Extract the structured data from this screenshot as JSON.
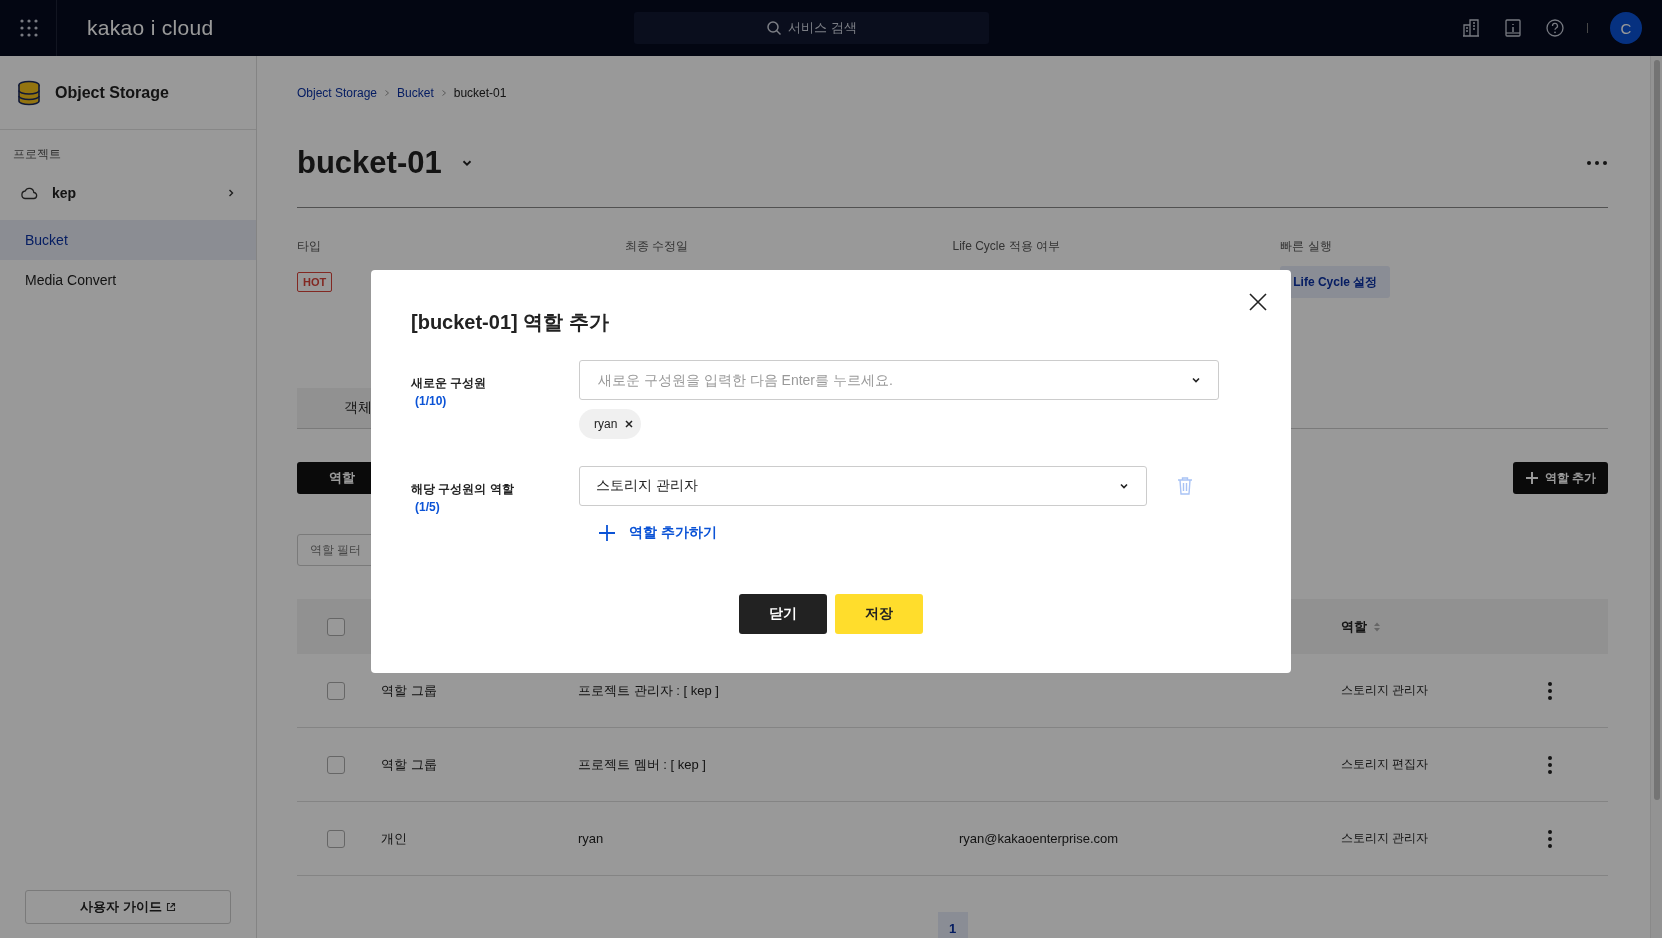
{
  "topbar": {
    "brand": "kakao i cloud",
    "search_placeholder": "서비스 검색",
    "avatar": "C"
  },
  "sidebar": {
    "service": "Object Storage",
    "section_label": "프로젝트",
    "project": "kep",
    "items": [
      {
        "label": "Bucket",
        "selected": true
      },
      {
        "label": "Media Convert",
        "selected": false
      }
    ],
    "guide_link": "사용자 가이드"
  },
  "breadcrumb": [
    "Object Storage",
    "Bucket",
    "bucket-01"
  ],
  "title": "bucket-01",
  "info": [
    {
      "label": "타입",
      "kind": "badge",
      "value": "HOT"
    },
    {
      "label": "최종 수정일"
    },
    {
      "label": "Life Cycle 적용 여부"
    },
    {
      "label": "빠른 실행",
      "kind": "button",
      "value": "Life Cycle 설정"
    }
  ],
  "tabs": [
    {
      "label": "객체",
      "selected": false
    }
  ],
  "role_toolbar": {
    "segment": "역할",
    "add_button": "역할 추가",
    "filter_placeholder": "역할 필터"
  },
  "table": {
    "select_all_checked": false,
    "role_header": "역할",
    "rows": [
      {
        "checked": false,
        "type": "역할 그룹",
        "name": "프로젝트 관리자 : [ kep ]",
        "role": "스토리지 관리자"
      },
      {
        "checked": false,
        "type": "역할 그룹",
        "name": "프로젝트 멤버 : [ kep ]",
        "role": "스토리지 편집자"
      },
      {
        "checked": false,
        "type": "개인",
        "name": "ryan",
        "email": "ryan@kakaoenterprise.com",
        "role": "스토리지 관리자"
      }
    ]
  },
  "pagination": [
    {
      "label": "1",
      "selected": true
    }
  ],
  "modal": {
    "title": "[bucket-01] 역할 추가",
    "member_label": "새로운 구성원",
    "member_count": "(1/10)",
    "member_placeholder": "새로운 구성원을 입력한 다음 Enter를 누르세요.",
    "chips": [
      "ryan"
    ],
    "role_label": "해당 구성원의 역할",
    "role_count": "(1/5)",
    "roles": [
      "스토리지 관리자"
    ],
    "add_role": "역할 추가하기",
    "buttons": [
      {
        "label": "닫기",
        "kind": "secondary"
      },
      {
        "label": "저장",
        "kind": "primary"
      }
    ]
  }
}
